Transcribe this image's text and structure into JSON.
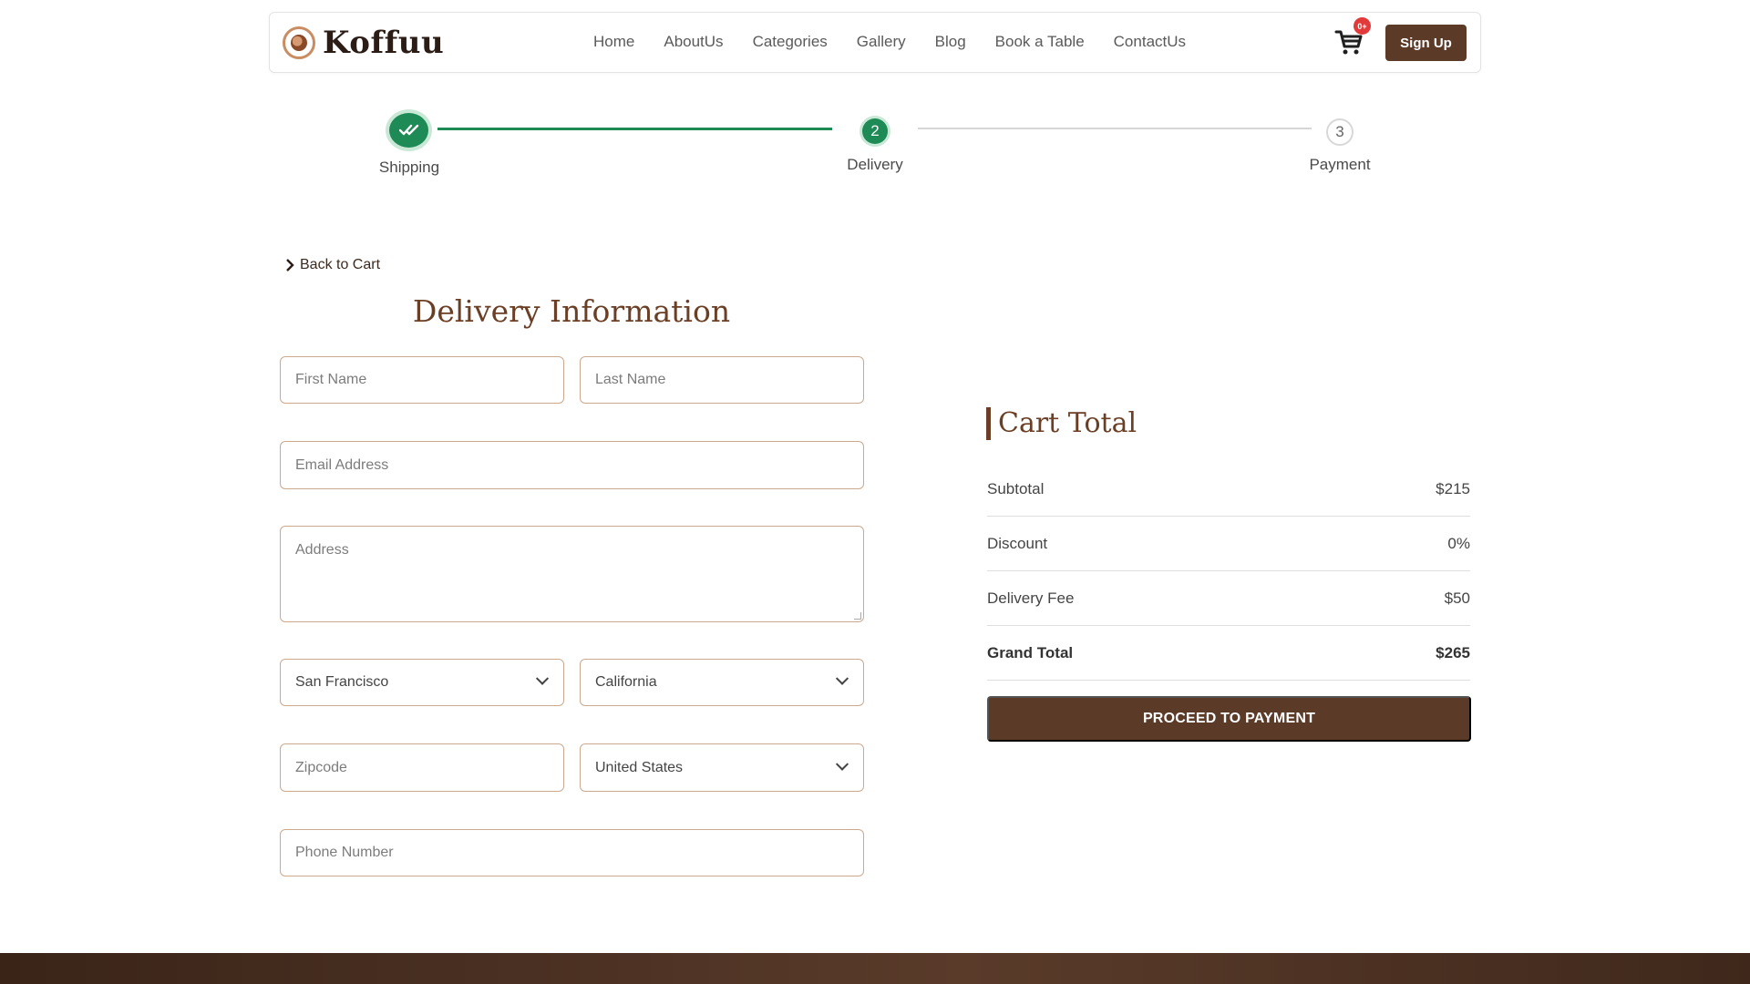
{
  "brand": {
    "name": "Koffuu"
  },
  "nav": {
    "items": [
      "Home",
      "AboutUs",
      "Categories",
      "Gallery",
      "Blog",
      "Book a Table",
      "ContactUs"
    ]
  },
  "cart": {
    "badge": "0+",
    "icon": "cart-icon"
  },
  "header": {
    "signup_label": "Sign Up"
  },
  "stepper": {
    "steps": [
      {
        "label": "Shipping",
        "number": "",
        "state": "done"
      },
      {
        "label": "Delivery",
        "number": "2",
        "state": "active"
      },
      {
        "label": "Payment",
        "number": "3",
        "state": "pending"
      }
    ],
    "accent": "#1e8a56"
  },
  "form": {
    "back_label": "Back to Cart",
    "title": "Delivery Information",
    "first_name_placeholder": "First Name",
    "last_name_placeholder": "Last Name",
    "email_placeholder": "Email Address",
    "address_placeholder": "Address",
    "city_value": "San Francisco",
    "state_value": "California",
    "zip_placeholder": "Zipcode",
    "country_value": "United States",
    "phone_placeholder": "Phone Number"
  },
  "summary": {
    "title": "Cart Total",
    "rows": [
      {
        "label": "Subtotal",
        "value": "$215"
      },
      {
        "label": "Discount",
        "value": "0%"
      },
      {
        "label": "Delivery Fee",
        "value": "$50"
      },
      {
        "label": "Grand Total",
        "value": "$265"
      }
    ],
    "proceed_label": "PROCEED TO PAYMENT"
  },
  "colors": {
    "brand_brown": "#5b3a28",
    "heading_brown": "#6a3f25",
    "badge_red": "#e23a3a"
  }
}
